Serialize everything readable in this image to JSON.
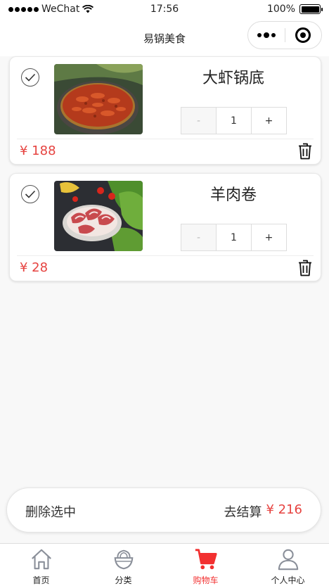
{
  "status_bar": {
    "carrier": "WeChat",
    "time": "17:56",
    "battery": "100%"
  },
  "nav": {
    "title": "易锅美食"
  },
  "cart": {
    "items": [
      {
        "name": "大虾锅底",
        "quantity": "1",
        "price": "¥ 188",
        "minus": "-",
        "plus": "+",
        "checked": true
      },
      {
        "name": "羊肉卷",
        "quantity": "1",
        "price": "¥ 28",
        "minus": "-",
        "plus": "+",
        "checked": true
      }
    ]
  },
  "summary": {
    "delete_label": "删除选中",
    "checkout_label": "去结算",
    "total": "¥ 216"
  },
  "tabbar": {
    "tabs": [
      {
        "label": "首页",
        "icon": "home-icon"
      },
      {
        "label": "分类",
        "icon": "bowl-icon"
      },
      {
        "label": "购物车",
        "icon": "cart-icon",
        "active": true
      },
      {
        "label": "个人中心",
        "icon": "user-icon"
      }
    ]
  },
  "colors": {
    "accent": "#e64340",
    "active_tab": "#f23030",
    "background": "#f8f8f8"
  }
}
